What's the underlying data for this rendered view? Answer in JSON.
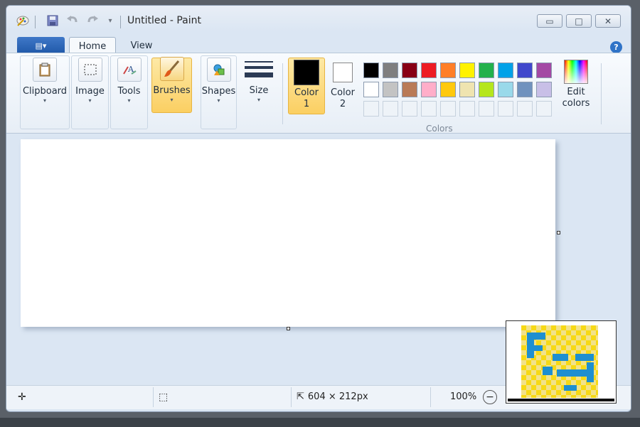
{
  "window": {
    "title": "Untitled - Paint"
  },
  "quick_access": {
    "icons": [
      "paint-app-icon",
      "save-icon",
      "undo-icon",
      "redo-icon",
      "customize-dropdown-icon"
    ]
  },
  "window_controls": {
    "minimize": "▭",
    "maximize": "□",
    "close": "✕"
  },
  "tabs": {
    "file_glyph": "▤▾",
    "home": "Home",
    "view": "View",
    "help": "?"
  },
  "ribbon": {
    "clipboard": "Clipboard",
    "image": "Image",
    "tools": "Tools",
    "brushes": "Brushes",
    "shapes": "Shapes",
    "size": "Size",
    "color1": [
      "Color",
      "1"
    ],
    "color2": [
      "Color",
      "2"
    ],
    "edit_colors": [
      "Edit",
      "colors"
    ],
    "colors_group": "Colors",
    "arrow": "▾"
  },
  "palette": {
    "row1": [
      "#000000",
      "#7f7f7f",
      "#880015",
      "#ed1c24",
      "#ff7f27",
      "#fff200",
      "#22b14c",
      "#00a2e8",
      "#3f48cc",
      "#a349a4"
    ],
    "row2": [
      "#ffffff",
      "#c3c3c3",
      "#b97a57",
      "#ffaec9",
      "#ffc90e",
      "#efe4b0",
      "#b5e61d",
      "#99d9ea",
      "#7092be",
      "#c8bfe7"
    ],
    "custom_slots": 10,
    "color1": "#000000",
    "color2": "#ffffff"
  },
  "status": {
    "cursor_glyph": "✛",
    "selection_glyph": "⬚",
    "dimensions_glyph": "⇱",
    "dimensions": "604 × 212px",
    "zoom": "100%",
    "zoom_out_glyph": "−"
  }
}
